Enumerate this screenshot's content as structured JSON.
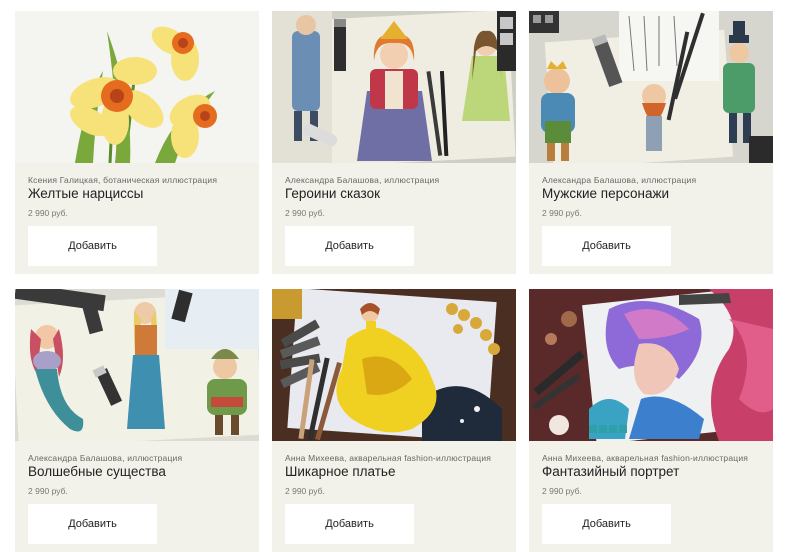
{
  "products": [
    {
      "image": "daffodils-illustration",
      "author": "Ксения Галицкая, ботаническая иллюстрация",
      "title": "Желтые нарциссы",
      "price": "2 990 руб.",
      "button": "Добавить"
    },
    {
      "image": "fairy-tale-heroines-illustration",
      "author": "Александра Балашова, иллюстрация",
      "title": "Героини сказок",
      "price": "2 990 руб.",
      "button": "Добавить"
    },
    {
      "image": "male-characters-illustration",
      "author": "Александра Балашова, иллюстрация",
      "title": "Мужские персонажи",
      "price": "2 990 руб.",
      "button": "Добавить"
    },
    {
      "image": "magical-creatures-illustration",
      "author": "Александра Балашова, иллюстрация",
      "title": "Волшебные существа",
      "price": "2 990 руб.",
      "button": "Добавить"
    },
    {
      "image": "yellow-dress-fashion-illustration",
      "author": "Анна Михеева, акварельная fashion-иллюстрация",
      "title": "Шикарное платье",
      "price": "2 990 руб.",
      "button": "Добавить"
    },
    {
      "image": "fantasy-portrait-illustration",
      "author": "Анна Михеева, акварельная fashion-иллюстрация",
      "title": "Фантазийный портрет",
      "price": "2 990 руб.",
      "button": "Добавить"
    }
  ]
}
